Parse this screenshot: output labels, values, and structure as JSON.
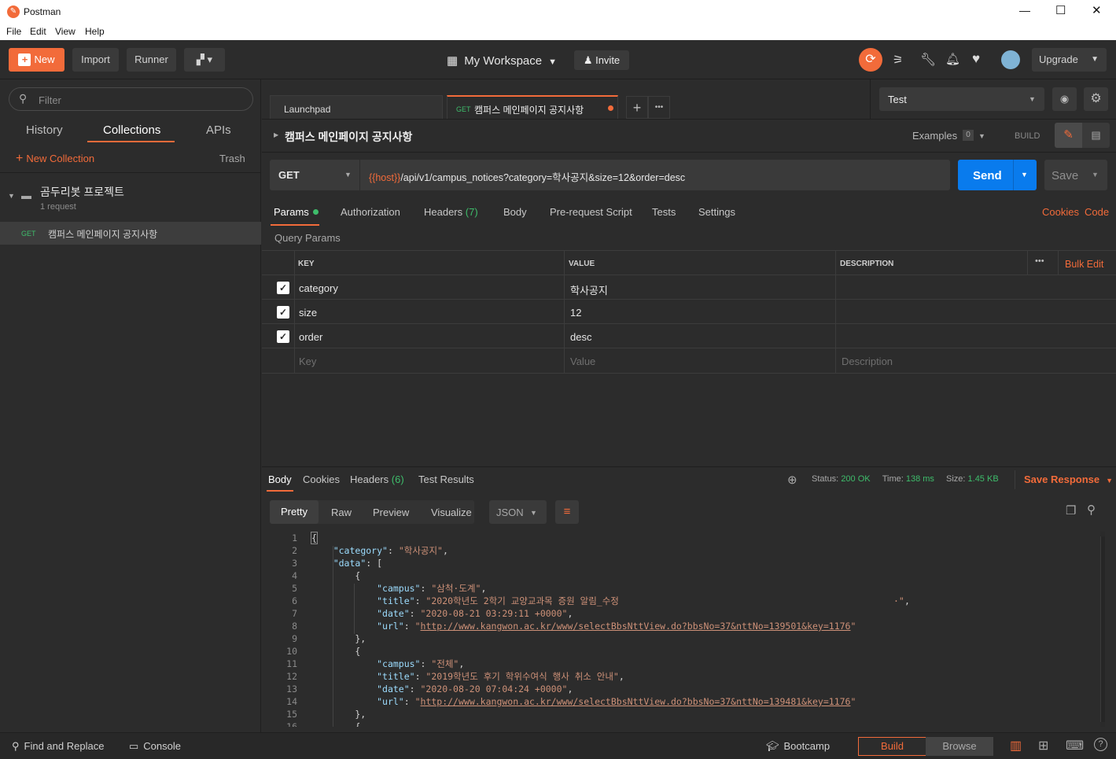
{
  "window": {
    "title": "Postman",
    "controls": [
      "—",
      "☐",
      "✕"
    ]
  },
  "menu": [
    "File",
    "Edit",
    "View",
    "Help"
  ],
  "header": {
    "new_label": "New",
    "import_label": "Import",
    "runner_label": "Runner",
    "workspace_label": "My Workspace",
    "invite_label": "Invite",
    "upgrade_label": "Upgrade"
  },
  "sidebar": {
    "filter_placeholder": "Filter",
    "tabs": [
      "History",
      "Collections",
      "APIs"
    ],
    "active_tab": "Collections",
    "new_collection_label": "New Collection",
    "trash_label": "Trash",
    "collection": {
      "name": "곰두리봇 프로젝트",
      "meta": "1 request"
    },
    "request": {
      "method": "GET",
      "name": "캠퍼스 메인페이지 공지사항"
    }
  },
  "tabs": {
    "items": [
      {
        "label": "Launchpad"
      },
      {
        "method": "GET",
        "label": "캠퍼스 메인페이지 공지사항"
      }
    ],
    "plus": "+",
    "more": "•••"
  },
  "environment": {
    "selected": "Test"
  },
  "request": {
    "title": "캠퍼스 메인페이지 공지사항",
    "examples_label": "Examples",
    "examples_count": "0",
    "build_label": "BUILD",
    "method": "GET",
    "url_var": "{{host}}",
    "url_rest": "/api/v1/campus_notices?category=학사공지&size=12&order=desc",
    "send_label": "Send",
    "save_label": "Save",
    "subtabs": [
      {
        "label": "Params"
      },
      {
        "label": "Authorization"
      },
      {
        "label": "Headers",
        "count": "(7)"
      },
      {
        "label": "Body"
      },
      {
        "label": "Pre-request Script"
      },
      {
        "label": "Tests"
      },
      {
        "label": "Settings"
      }
    ],
    "cookies_label": "Cookies",
    "code_label": "Code",
    "query_params_label": "Query Params",
    "columns": [
      "KEY",
      "VALUE",
      "DESCRIPTION"
    ],
    "bulk_edit_label": "Bulk Edit",
    "params": [
      {
        "key": "category",
        "value": "학사공지",
        "description": ""
      },
      {
        "key": "size",
        "value": "12",
        "description": ""
      },
      {
        "key": "order",
        "value": "desc",
        "description": ""
      }
    ],
    "placeholders": {
      "key": "Key",
      "value": "Value",
      "description": "Description"
    }
  },
  "response": {
    "tabs": [
      {
        "label": "Body"
      },
      {
        "label": "Cookies"
      },
      {
        "label": "Headers",
        "count": "(6)"
      },
      {
        "label": "Test Results"
      }
    ],
    "status_label": "Status:",
    "status_value": "200 OK",
    "time_label": "Time:",
    "time_value": "138 ms",
    "size_label": "Size:",
    "size_value": "1.45 KB",
    "save_response_label": "Save Response",
    "view_modes": [
      "Pretty",
      "Raw",
      "Preview",
      "Visualize"
    ],
    "format": "JSON",
    "line_numbers": [
      "1",
      "2",
      "3",
      "4",
      "5",
      "6",
      "7",
      "8",
      "9",
      "10",
      "11",
      "12",
      "13",
      "14",
      "15",
      "16"
    ],
    "body": {
      "category_key": "\"category\"",
      "category_val": "\"학사공지\"",
      "data_key": "\"data\"",
      "items": [
        {
          "campus": "\"삼척·도계\"",
          "title": "\"2020학년도 2학기 교양교과목 증원 알림_수정",
          "title_tail": "·\"",
          "date": "\"2020-08-21 03:29:11 +0000\"",
          "url": "http://www.kangwon.ac.kr/www/selectBbsNttView.do?bbsNo=37&nttNo=139501&key=1176"
        },
        {
          "campus": "\"전체\"",
          "title": "\"2019학년도 후기 학위수여식 행사 취소 안내\"",
          "title_tail": "",
          "date": "\"2020-08-20 07:04:24 +0000\"",
          "url": "http://www.kangwon.ac.kr/www/selectBbsNttView.do?bbsNo=37&nttNo=139481&key=1176"
        }
      ]
    }
  },
  "footer": {
    "find_replace_label": "Find and Replace",
    "console_label": "Console",
    "bootcamp_label": "Bootcamp",
    "build_label": "Build",
    "browse_label": "Browse"
  },
  "colors": {
    "accent": "#f26b3a",
    "send": "#097bed",
    "ok": "#3ebd6b"
  }
}
